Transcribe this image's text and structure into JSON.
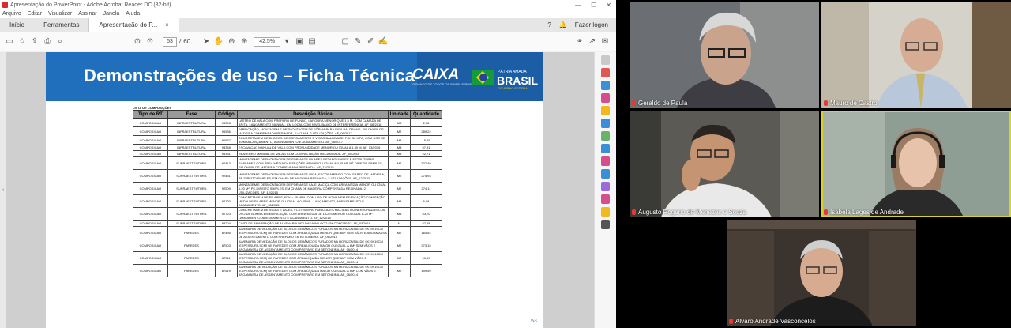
{
  "window": {
    "title": "Apresentação do PowerPoint - Adobe Acrobat Reader DC (32-bit)",
    "controls": [
      "—",
      "☐",
      "✕"
    ]
  },
  "menu": [
    "Arquivo",
    "Editar",
    "Visualizar",
    "Assinar",
    "Janela",
    "Ajuda"
  ],
  "tabs": {
    "home": "Início",
    "tools": "Ferramentas",
    "document": "Apresentação do P...",
    "close": "×",
    "help_icon": "?",
    "bell_icon": "🔔",
    "login": "Fazer logon"
  },
  "toolbar": {
    "page_current": "53",
    "page_sep": "/",
    "page_total": "60",
    "zoom": "42,5%"
  },
  "slide": {
    "title": "Demonstrações de uso – Ficha Técnica",
    "caixa_logo": "CAIXA",
    "caixa_sub": "O BANCO DE TODOS OS BRASILEIROS",
    "gov_top": "PÁTRIA AMADA",
    "gov_big": "BRASIL",
    "gov_sub": "GOVERNO FEDERAL",
    "caption": "LISTA DE COMPOSIÇÕES",
    "page_number": "53",
    "headers": [
      "Tipo de RT",
      "Fase",
      "Código",
      "Descrição Básica",
      "Unidade",
      "Quantidade"
    ],
    "rows": [
      {
        "tipo": "COMPOSICAO",
        "fase": "INFRAESTRUTURA",
        "codigo": "93303",
        "desc": "LASTRO DE VALA COM PREPARO DE FUNDO, LARGURA MENOR QUE 1,5 M, COM CAMADA DE BRITA, LANÇAMENTO MANUAL, EM LOCAL COM NÍVEL BAIXO DE INTERFERÊNCIA. AF_06/2016",
        "unid": "M3",
        "qtd": "2,08"
      },
      {
        "tipo": "COMPOSICAO",
        "fase": "INFRAESTRUTURA",
        "codigo": "96536",
        "desc": "FABRICAÇÃO, MONTAGEM E DESMONTAGEM DE FÔRMA PARA VIGA BALDRAME, EM CHAPA DE MADEIRA COMPENSADA RESINADA, E=17 MM, 2 UTILIZAÇÕES. AF_06/2017",
        "unid": "M2",
        "qtd": "289,22"
      },
      {
        "tipo": "COMPOSICAO",
        "fase": "INFRAESTRUTURA",
        "codigo": "96557",
        "desc": "CONCRETAGEM DE BLOCOS DE COROAMENTO E VIGAS BALDRAME, FCK 30 MPA, COM USO DE BOMBA LANÇAMENTO, ADENSAMENTO E ACABAMENTO. AF_06/2017",
        "unid": "M3",
        "qtd": "15,49"
      },
      {
        "tipo": "COMPOSICAO",
        "fase": "INFRAESTRUTURA",
        "codigo": "93358",
        "desc": "ESCAVAÇÃO MANUAL DE VALA COM PROFUNDIDADE MENOR OU IGUAL A 1,30 M. AF_03/2016",
        "unid": "M3",
        "qtd": "57,91"
      },
      {
        "tipo": "COMPOSICAO",
        "fase": "INFRAESTRUTURA",
        "codigo": "93381",
        "desc": "REATERRO MANUAL DE VALAS COM COMPACTAÇÃO MECANIZADA. AF_04/2016",
        "unid": "M3",
        "qtd": "22,71"
      },
      {
        "tipo": "COMPOSICAO",
        "fase": "SUPRAESTRUTURA",
        "codigo": "92413",
        "desc": "MONTAGEM E DESMONTAGEM DE FÔRMA DE PILARES RETANGULARES E ESTRUTURAS SIMILARES COM ÁREA MÉDIA DAS SEÇÕES MENOR OU IGUAL A 0,25 M², PÉ-DIREITO SIMPLES, EM CHAPA DE MADEIRA COMPENSADA RESINADA. AF_12/2015",
        "unid": "M2",
        "qtd": "327,49"
      },
      {
        "tipo": "COMPOSICAO",
        "fase": "SUPRAESTRUTURA",
        "codigo": "92451",
        "desc": "MONTAGEM E DESMONTAGEM DE FÔRMA DE VIGA, ESCORAMENTO COM GARFO DE MADEIRA, PÉ-DIREITO SIMPLES, EM CHAPA DE MADEIRA RESINADA, 2 UTILIZAÇÕES. AF_12/2015",
        "unid": "M2",
        "qtd": "275,93"
      },
      {
        "tipo": "COMPOSICAO",
        "fase": "SUPRAESTRUTURA",
        "codigo": "92509",
        "desc": "MONTAGEM E DESMONTAGEM DE FÔRMA DE LAJE MACIÇA COM ÁREA MÉDIA MENOR OU IGUAL A 20 M², PÉ-DIREITO SIMPLES, EM CHAPA DE MADEIRA COMPENSADA RESINADA, 2 UTILIZAÇÕES. AF_12/2015",
        "unid": "M2",
        "qtd": "274,11"
      },
      {
        "tipo": "COMPOSICAO",
        "fase": "SUPRAESTRUTURA",
        "codigo": "92720",
        "desc": "CONCRETAGEM DE PILARES, FCK = 25 MPA, COM USO DE BOMBA EM EDIFICAÇÃO COM SEÇÃO MÉDIA DE PILARES MENOR OU IGUAL A 0,25 M² - LANÇAMENTO, ADENSAMENTO E ACABAMENTO. AF_12/2015",
        "unid": "M3",
        "qtd": "6,88"
      },
      {
        "tipo": "COMPOSICAO",
        "fase": "SUPRAESTRUTURA",
        "codigo": "92723",
        "desc": "CONCRETAGEM DE VIGAS E LAJES, FCK=20 MPA, PARA LAJES MACIÇAS OU NERVURADAS COM USO DE BOMBA EM EDIFICAÇÃO COM ÁREA MÉDIA DE LAJES MENOR OU IGUAL A 20 M² - LANÇAMENTO, ADENSAMENTO E ACABAMENTO. AF_12/2015",
        "unid": "M3",
        "qtd": "53,70"
      },
      {
        "tipo": "COMPOSICAO",
        "fase": "SUPRAESTRUTURA",
        "codigo": "93204",
        "desc": "CINTA DE AMARRAÇÃO DE ALVENARIA MOLDADA IN LOCO EM CONCRETO. AF_03/2016",
        "unid": "M",
        "qtd": "87,58"
      },
      {
        "tipo": "COMPOSICAO",
        "fase": "PAREDES",
        "codigo": "87495",
        "desc": "ALVENARIA DE VEDAÇÃO DE BLOCOS CERÂMICOS FURADOS NA HORIZONTAL DE 9X19X19CM (ESPESSURA 9CM) DE PAREDES COM ÁREA LÍQUIDA MENOR QUE 6M² SEM VÃOS E ARGAMASSA DE ASSENTAMENTO COM PREPARO EM BETONEIRA. AF_06/2014",
        "unid": "M2",
        "qtd": "164,54"
      },
      {
        "tipo": "COMPOSICAO",
        "fase": "PAREDES",
        "codigo": "87503",
        "desc": "ALVENARIA DE VEDAÇÃO DE BLOCOS CERÂMICOS FURADOS NA HORIZONTAL DE 9X19X19CM (ESPESSURA 9CM) DE PAREDES COM ÁREA LÍQUIDA MAIOR OU IGUAL A 6M² SEM VÃOS E ARGAMASSA DE ASSENTAMENTO COM PREPARO EM BETONEIRA. AF_06/2014",
        "unid": "M2",
        "qtd": "373,15"
      },
      {
        "tipo": "COMPOSICAO",
        "fase": "PAREDES",
        "codigo": "87511",
        "desc": "ALVENARIA DE VEDAÇÃO DE BLOCOS CERÂMICOS FURADOS NA HORIZONTAL DE 9X19X19CM (ESPESSURA 9CM) DE PAREDES COM ÁREA LÍQUIDA MENOR QUE 6M² COM VÃOS E ARGAMASSA DE ASSENTAMENTO COM PREPARO EM BETONEIRA. AF_06/2014",
        "unid": "M2",
        "qtd": "90,19"
      },
      {
        "tipo": "COMPOSICAO",
        "fase": "PAREDES",
        "codigo": "87519",
        "desc": "ALVENARIA DE VEDAÇÃO DE BLOCOS CERÂMICOS FURADOS NA HORIZONTAL DE 9X19X19CM (ESPESSURA 9CM) DE PAREDES COM ÁREA LÍQUIDA MAIOR OU IGUAL A 6M² COM VÃOS E ARGAMASSA DE ASSENTAMENTO COM PREPARO EM BETONEIRA. AF_06/2014",
        "unid": "M2",
        "qtd": "199,59"
      }
    ]
  },
  "participants": [
    {
      "name": "Geraldo de Paula",
      "bg": "#6b6f74",
      "face": "#c9a38c",
      "shirt": "#3e3d44"
    },
    {
      "name": "Mauro de Castro",
      "bg": "#d4d2c9",
      "face": "#d6ad94",
      "shirt": "#b9c7da"
    },
    {
      "name": "Augusto Rogério de Menezes e Souza",
      "bg": "#5b5a55",
      "face": "#c59473",
      "shirt": "#e9e9e9"
    },
    {
      "name": "Isabela Lages de Andrade",
      "bg": "#8f9e94",
      "face": "#e7c3ab",
      "shirt": "#2a2a2a"
    },
    {
      "name": "Alvaro Andrade Vasconcelos",
      "bg": "#3b342e",
      "face": "#d7ab8f",
      "shirt": "#1c1c1c"
    }
  ],
  "colors": {
    "banner_blue": "#1f6fbd",
    "active_speaker_outline": "#dcd12a",
    "muted_mic": "#e53935"
  }
}
